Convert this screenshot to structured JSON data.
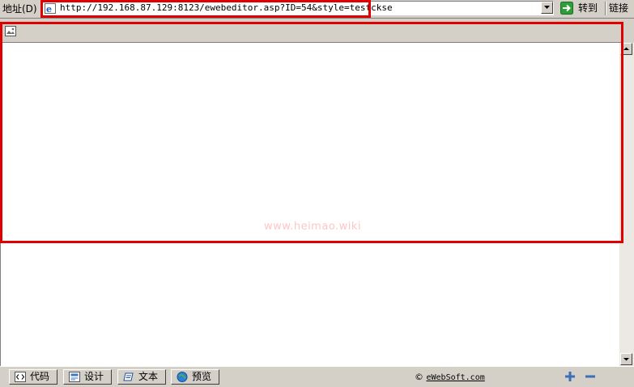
{
  "address_bar": {
    "label": "地址(D)",
    "url": "http://192.168.87.129:8123/ewebeditor.asp?ID=54&style=testckse",
    "go_label": "转到",
    "links_label": "链接"
  },
  "editor": {
    "watermark": "www.heimao.wiki"
  },
  "status_bar": {
    "tabs": [
      {
        "label": "代码",
        "icon": "code-icon"
      },
      {
        "label": "设计",
        "icon": "design-icon"
      },
      {
        "label": "文本",
        "icon": "text-icon"
      },
      {
        "label": "预览",
        "icon": "preview-icon"
      }
    ],
    "copyright_symbol": "©",
    "copyright_link": "eWebSoft.com"
  },
  "colors": {
    "highlight": "#e00000",
    "chrome": "#d4d0c8"
  }
}
